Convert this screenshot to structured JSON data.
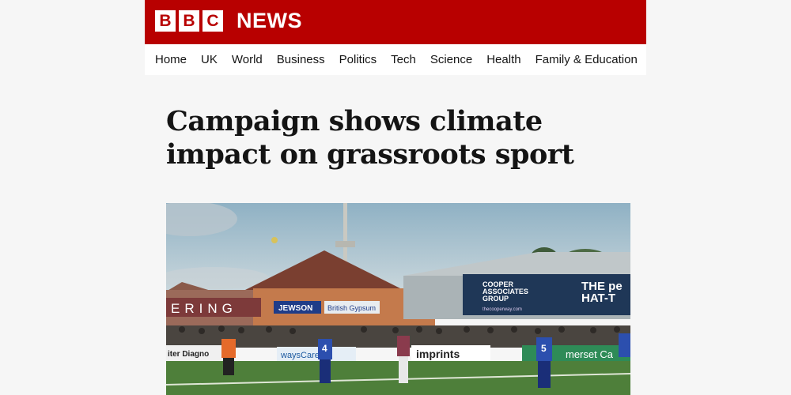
{
  "brand": {
    "letters": [
      "B",
      "B",
      "C"
    ],
    "name": "NEWS",
    "color": "#b80000"
  },
  "nav": {
    "items": [
      "Home",
      "UK",
      "World",
      "Business",
      "Politics",
      "Tech",
      "Science",
      "Health",
      "Family & Education"
    ]
  },
  "article": {
    "headline": "Campaign shows climate impact on grassroots sport"
  },
  "image": {
    "signs": {
      "club_banner": "ERING",
      "jewson": "JEWSON",
      "british_gypsum": "British Gypsum",
      "cooper_line1": "COOPER",
      "cooper_line2": "ASSOCIATES",
      "cooper_line3": "GROUP",
      "cooper_web": "thecooperway.com",
      "hat_line1": "THE pe",
      "hat_line2": "HAT-T",
      "imprints": "imprints",
      "wayscare": "waysCare",
      "somerset": "merset Ca",
      "diagnostic": "iter Diagno"
    },
    "shirt_numbers": {
      "player_a": "4",
      "player_b": "5"
    }
  }
}
